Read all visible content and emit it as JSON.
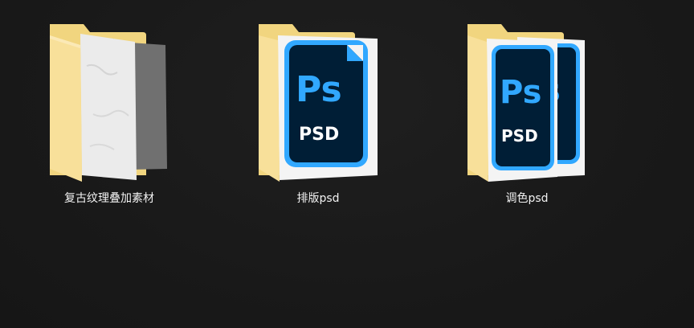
{
  "desktop": {
    "items": [
      {
        "label": "复古纹理叠加素材",
        "icon": "folder-texture-icon"
      },
      {
        "label": "排版psd",
        "icon": "folder-psd-icon"
      },
      {
        "label": "调色psd",
        "icon": "folder-psd-stack-icon"
      }
    ]
  },
  "colors": {
    "background": "#1a1a1a",
    "folder_back": "#f3d98b",
    "folder_front": "#f8e3a2",
    "ps_blue": "#31a8ff",
    "ps_dark": "#001e36"
  },
  "psd_badge": {
    "ps_text": "Ps",
    "psd_text": "PSD"
  }
}
